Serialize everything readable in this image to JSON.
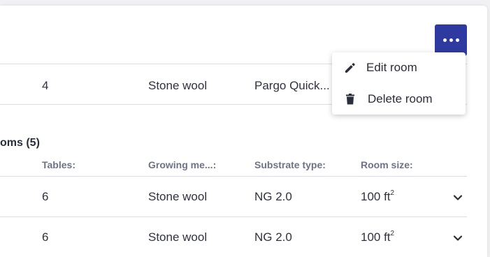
{
  "toolbar": {
    "more_icon": "ellipsis-horizontal-icon"
  },
  "current_room": {
    "tables": "4",
    "growing_medium": "Stone wool",
    "substrate_type": "Pargo Quick..."
  },
  "rooms_section": {
    "title": "oms (5)",
    "headers": {
      "tables": "Tables:",
      "growing_medium": "Growing me...:",
      "substrate_type": "Substrate type:",
      "room_size": "Room size:"
    },
    "rows": [
      {
        "tables": "6",
        "growing_medium": "Stone wool",
        "substrate_type": "NG 2.0",
        "room_size": "100 ft",
        "room_size_unit_exp": "2"
      },
      {
        "tables": "6",
        "growing_medium": "Stone wool",
        "substrate_type": "NG 2.0",
        "room_size": "100 ft",
        "room_size_unit_exp": "2"
      }
    ]
  },
  "menu": {
    "items": [
      {
        "label": "Edit room",
        "icon": "pencil-icon"
      },
      {
        "label": "Delete room",
        "icon": "trash-icon"
      }
    ]
  },
  "colors": {
    "accent": "#2f3aa0",
    "text": "#2a2d3a",
    "header_text": "#6e7386",
    "divider": "#dcdde3"
  }
}
